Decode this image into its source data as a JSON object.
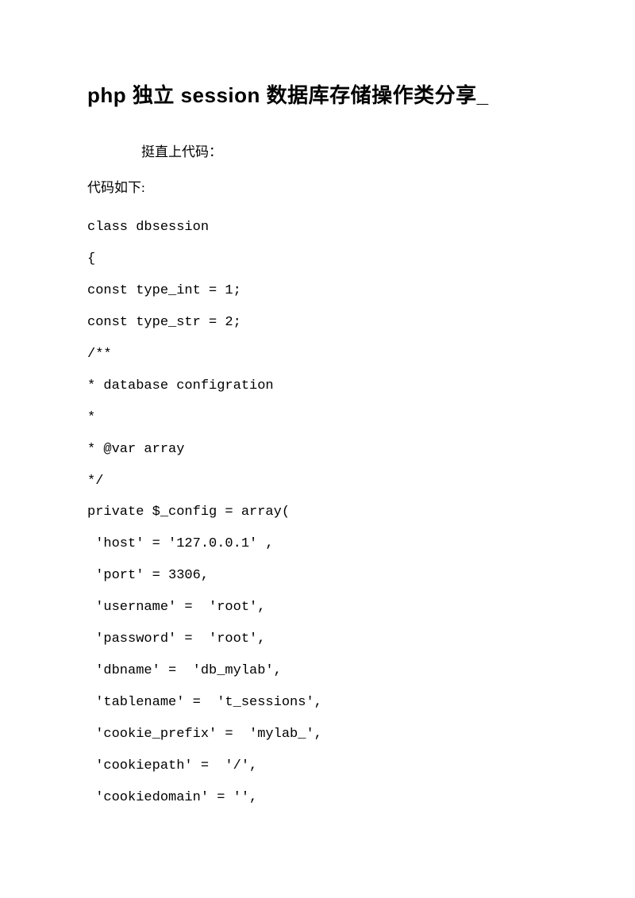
{
  "title": "php 独立 session 数据库存储操作类分享_",
  "intro": "挺直上代码：",
  "label": "代码如下:",
  "code_lines": [
    "class dbsession",
    "{",
    "const type_int = 1;",
    "const type_str = 2;",
    "/**",
    "* database configration",
    "*",
    "* @var array",
    "*/",
    "private $_config = array(",
    " 'host' = '127.0.0.1' ,",
    " 'port' = 3306,",
    " 'username' =  'root',",
    " 'password' =  'root',",
    " 'dbname' =  'db_mylab',",
    " 'tablename' =  't_sessions',",
    " 'cookie_prefix' =  'mylab_',",
    " 'cookiepath' =  '/',",
    " 'cookiedomain' = '',"
  ]
}
